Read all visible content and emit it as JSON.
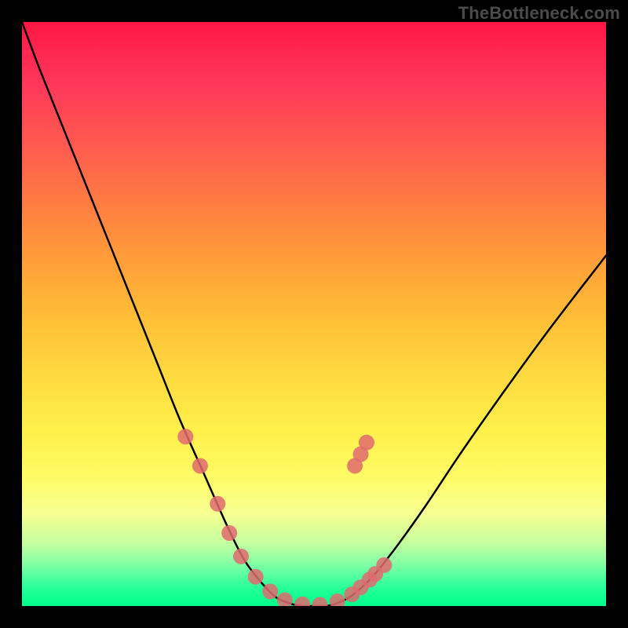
{
  "watermark": "TheBottleneck.com",
  "chart_data": {
    "type": "line",
    "title": "",
    "xlabel": "",
    "ylabel": "",
    "xlim": [
      0,
      100
    ],
    "ylim": [
      0,
      100
    ],
    "grid": false,
    "background": {
      "type": "vertical_gradient",
      "stops": [
        {
          "pos": 0,
          "color": "#ff1744"
        },
        {
          "pos": 10,
          "color": "#ff355a"
        },
        {
          "pos": 22,
          "color": "#ff5d4e"
        },
        {
          "pos": 35,
          "color": "#ff8a3d"
        },
        {
          "pos": 48,
          "color": "#ffb636"
        },
        {
          "pos": 60,
          "color": "#ffd83f"
        },
        {
          "pos": 70,
          "color": "#fff04a"
        },
        {
          "pos": 78,
          "color": "#fffb66"
        },
        {
          "pos": 84,
          "color": "#f8ff90"
        },
        {
          "pos": 89,
          "color": "#c8ff9f"
        },
        {
          "pos": 93,
          "color": "#7fffa6"
        },
        {
          "pos": 97,
          "color": "#25ff9a"
        },
        {
          "pos": 100,
          "color": "#00ff8c"
        }
      ]
    },
    "series": [
      {
        "name": "bottleneck_curve",
        "stroke": "#000000",
        "stroke_width": 2.5,
        "x": [
          0,
          3,
          7,
          11,
          15,
          19,
          23,
          27,
          31,
          35,
          38,
          41,
          43.5,
          46,
          48,
          50,
          52,
          54,
          56.5,
          60,
          64,
          69,
          75,
          82,
          90,
          100
        ],
        "y": [
          100,
          92,
          82,
          72,
          62,
          52,
          42,
          32,
          23,
          14,
          8,
          4,
          1.5,
          0.4,
          0,
          0,
          0,
          0.5,
          1.8,
          5,
          10,
          17,
          26,
          36,
          47,
          60
        ]
      }
    ],
    "markers": [
      {
        "name": "highlight_points",
        "shape": "circle",
        "fill": "#e06a6e",
        "fill_opacity": 0.85,
        "radius": 10,
        "points": [
          {
            "x": 28.0,
            "y": 29.0
          },
          {
            "x": 30.5,
            "y": 24.0
          },
          {
            "x": 33.5,
            "y": 17.5
          },
          {
            "x": 35.5,
            "y": 12.5
          },
          {
            "x": 37.5,
            "y": 8.5
          },
          {
            "x": 40.0,
            "y": 5.0
          },
          {
            "x": 42.5,
            "y": 2.5
          },
          {
            "x": 45.0,
            "y": 1.0
          },
          {
            "x": 48.0,
            "y": 0.3
          },
          {
            "x": 51.0,
            "y": 0.2
          },
          {
            "x": 54.0,
            "y": 0.8
          },
          {
            "x": 56.5,
            "y": 2.0
          },
          {
            "x": 58.0,
            "y": 3.2
          },
          {
            "x": 59.5,
            "y": 4.5
          },
          {
            "x": 60.5,
            "y": 5.5
          },
          {
            "x": 62.0,
            "y": 7.0
          },
          {
            "x": 57.0,
            "y": 24.0
          },
          {
            "x": 58.0,
            "y": 26.0
          },
          {
            "x": 59.0,
            "y": 28.0
          }
        ]
      }
    ]
  }
}
